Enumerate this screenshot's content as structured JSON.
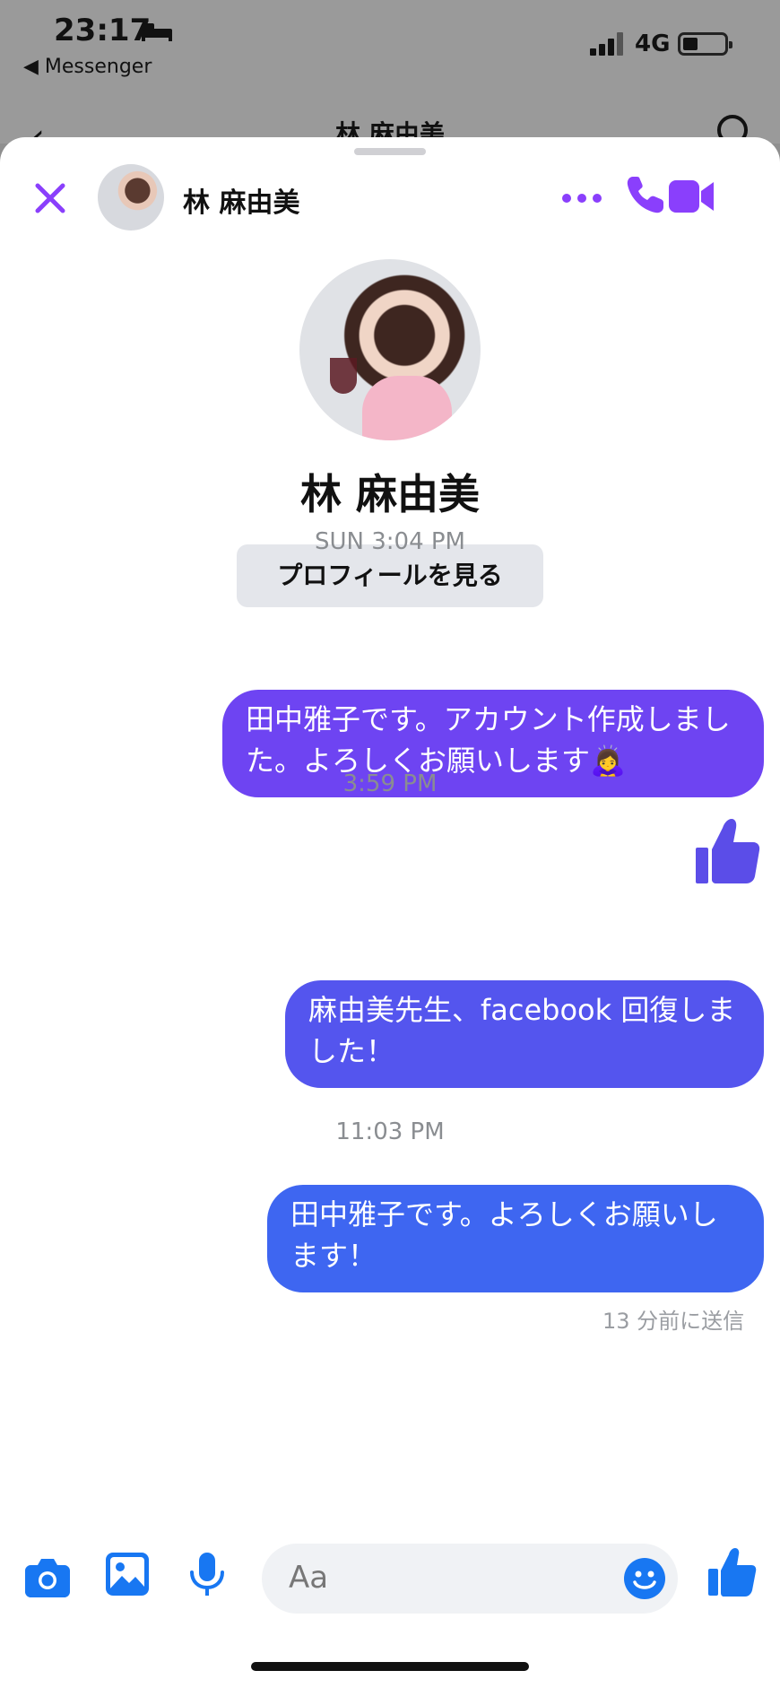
{
  "status_bar": {
    "time": "23:17",
    "back_app": "◀ Messenger",
    "network": "4G"
  },
  "background_header": {
    "back": "‹",
    "title": "林 麻由美"
  },
  "sheet_header": {
    "contact_name": "林 麻由美"
  },
  "profile": {
    "name": "林 麻由美",
    "view_profile_label": "プロフィールを見る"
  },
  "messages": [
    {
      "timestamp": "SUN 3:04 PM",
      "text": "田中雅子です。アカウント作成しました。よろしくお願いします🙇‍♀️"
    },
    {
      "timestamp": "3:59 PM",
      "text": "麻由美先生、facebook 回復しました！"
    },
    {
      "timestamp": "11:03 PM",
      "text": "田中雅子です。よろしくお願いします！"
    }
  ],
  "sent_status": "13 分前に送信",
  "composer": {
    "placeholder": "Aa"
  },
  "colors": {
    "accent_purple": "#8a3ffc",
    "bubble_1": "#6e44f2",
    "bubble_2": "#5455ee",
    "bubble_3": "#3e66f1",
    "composer_blue": "#1877f2"
  }
}
